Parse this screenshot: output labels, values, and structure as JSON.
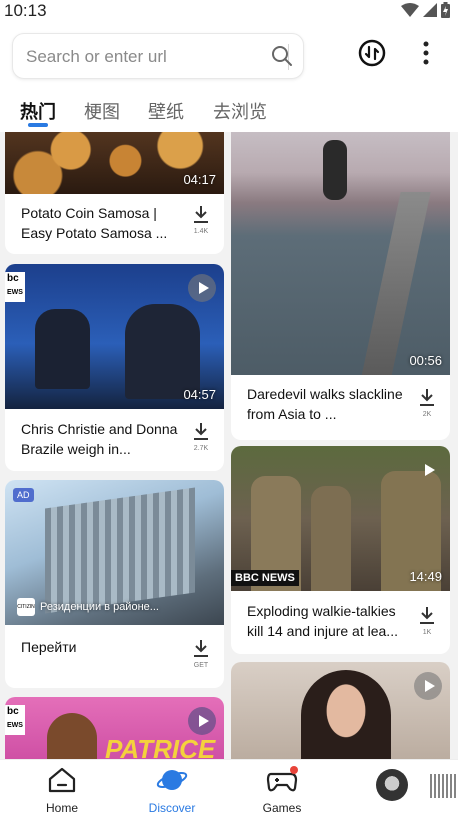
{
  "status_bar": {
    "time": "10:13"
  },
  "header": {
    "search": {
      "placeholder": "Search or enter url"
    },
    "tabs": [
      {
        "label": "热门",
        "active": true
      },
      {
        "label": "梗图",
        "active": false
      },
      {
        "label": "壁纸",
        "active": false
      },
      {
        "label": "去浏览",
        "active": false
      }
    ]
  },
  "feed": {
    "left": [
      {
        "title": "Potato Coin Samosa | Easy Potato Samosa ...",
        "duration": "04:17",
        "downloads": "1.4K"
      },
      {
        "title": "Chris Christie and Donna Brazile weigh in...",
        "duration": "04:57",
        "downloads": "2.7K",
        "logo": "bc",
        "logo_sub": "EWS"
      },
      {
        "title": "Перейти",
        "ad_badge": "AD",
        "ad_brand_logo": "CITIZIN",
        "ad_text": "Резиденции в районе...",
        "action": "GET"
      },
      {
        "logo": "bc",
        "logo_sub": "EWS",
        "overlay_text": "PATRICE"
      }
    ],
    "right": [
      {
        "title": "Daredevil walks slackline from Asia to ...",
        "duration": "00:56",
        "downloads": "2K"
      },
      {
        "title": "Exploding walkie-talkies kill 14 and injure at lea...",
        "duration": "14:49",
        "downloads": "1K",
        "network": "BBC NEWS"
      },
      {}
    ]
  },
  "bottom_nav": [
    {
      "label": "Home",
      "active": false
    },
    {
      "label": "Discover",
      "active": true
    },
    {
      "label": "Games",
      "active": false,
      "badge": true
    }
  ],
  "colors": {
    "accent": "#2a7ae2",
    "badge_red": "#e8443a"
  }
}
